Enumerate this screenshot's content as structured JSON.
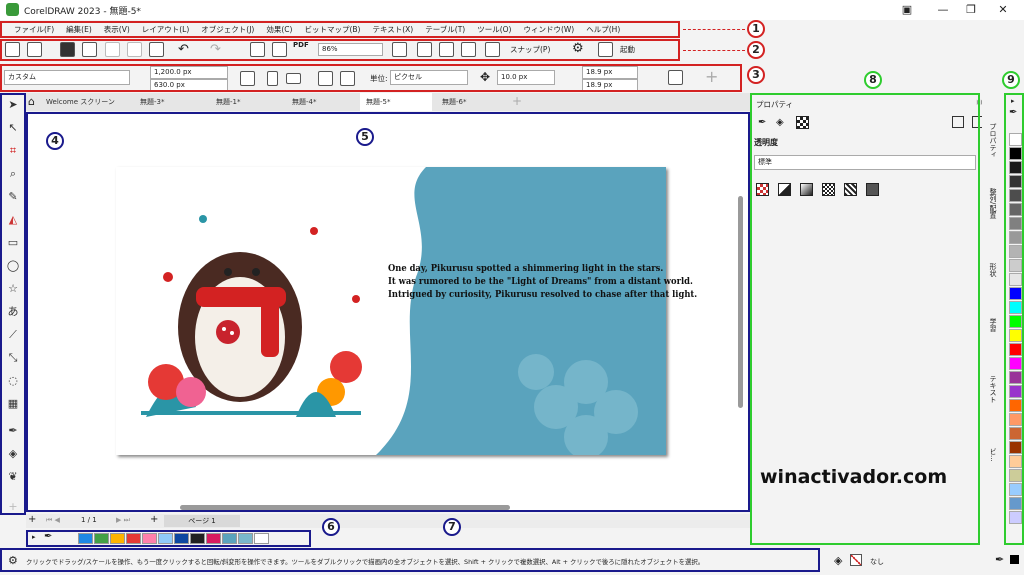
{
  "window": {
    "title": "CorelDRAW 2023 - 無題-5*"
  },
  "menu": [
    "ファイル(F)",
    "編集(E)",
    "表示(V)",
    "レイアウト(L)",
    "オブジェクト(J)",
    "効果(C)",
    "ビットマップ(B)",
    "テキスト(X)",
    "テーブル(T)",
    "ツール(O)",
    "ウィンドウ(W)",
    "ヘルプ(H)"
  ],
  "toolbar": {
    "zoom": "86%",
    "snap_label": "スナップ(P)",
    "launch_label": "起動"
  },
  "propbar": {
    "preset": "カスタム",
    "width": "1,200.0 px",
    "height": "630.0 px",
    "units_label": "単位:",
    "units": "ピクセル",
    "nudge": "10.0 px",
    "dup_x": "18.9 px",
    "dup_y": "18.9 px"
  },
  "tabs": [
    "Welcome スクリーン",
    "無題-3*",
    "無題-1*",
    "無題-4*",
    "無題-5*",
    "無題-6*"
  ],
  "story": [
    "One day, Pikurusu spotted a shimmering light in the stars.",
    "It was rumored to be the \"Light of Dreams\" from a distant world.",
    "Intrigued by curiosity, Pikurusu resolved to chase after that light."
  ],
  "pagenav": {
    "counter": "1 / 1",
    "page_tab": "ページ 1"
  },
  "docker": {
    "title": "プロパティ",
    "section": "透明度",
    "mode": "標準"
  },
  "docker_tabs": [
    "プロパティ",
    "整列/配置",
    "形状",
    "学習",
    "テキスト",
    "ビ..."
  ],
  "status": {
    "text": "クリックでドラッグ/スケールを操作、もう一度クリックすると回転/斜変形を操作できます。ツールをダブルクリックで描画内の全オブジェクトを選択、Shift + クリックで複数選択、Alt + クリックで後ろに隠れたオブジェクトを選択。",
    "fill_label": "なし"
  },
  "watermark": "winactivador.com",
  "callouts": [
    "1",
    "2",
    "3",
    "4",
    "5",
    "6",
    "7",
    "8",
    "9"
  ],
  "colors": {
    "accent_red": "#d32222",
    "accent_blue": "#1a1a8c",
    "accent_green": "#2ecc2e",
    "canvas_teal": "#5aa3bd"
  },
  "palette": [
    "#ffffff",
    "#000000",
    "#1a1a1a",
    "#333333",
    "#4d4d4d",
    "#666666",
    "#808080",
    "#999999",
    "#b3b3b3",
    "#cccccc",
    "#e6e6e6",
    "#0000ff",
    "#00ffff",
    "#00ff00",
    "#ffff00",
    "#ff0000",
    "#ff00ff",
    "#993399",
    "#9933cc",
    "#ff6600",
    "#ff9966",
    "#cc6633",
    "#993300",
    "#ffcc99",
    "#cccc99",
    "#99ccff",
    "#6699cc",
    "#ccccff"
  ],
  "doc_palette": [
    "#1e88e5",
    "#43a047",
    "#ffb300",
    "#e53935",
    "#ff80ab",
    "#90caf9",
    "#0d47a1",
    "#212121",
    "#d81b60",
    "#5aa3bd",
    "#79b8cc",
    "#ffffff"
  ]
}
